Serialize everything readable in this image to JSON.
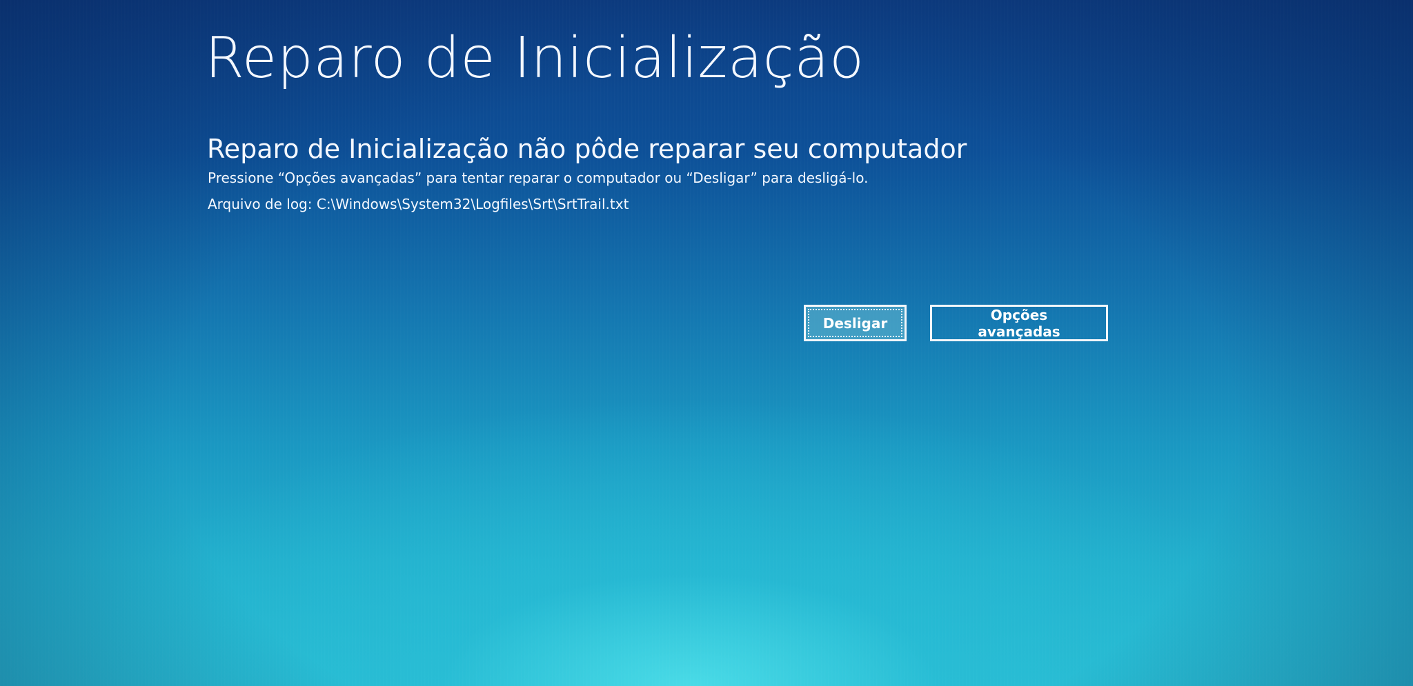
{
  "page": {
    "title": "Reparo de Inicialização",
    "subtitle": "Reparo de Inicialização não pôde reparar seu computador",
    "instruction": "Pressione “Opções avançadas” para tentar reparar o computador ou “Desligar” para desligá-lo.",
    "log_label": "Arquivo de log: C:\\Windows\\System32\\Logfiles\\Srt\\SrtTrail.txt"
  },
  "buttons": {
    "shutdown_label": "Desligar",
    "advanced_label": "Opções avançadas"
  },
  "colors": {
    "background_top": "#0d3f86",
    "background_bottom": "#28bcd2",
    "text": "#ffffff"
  }
}
